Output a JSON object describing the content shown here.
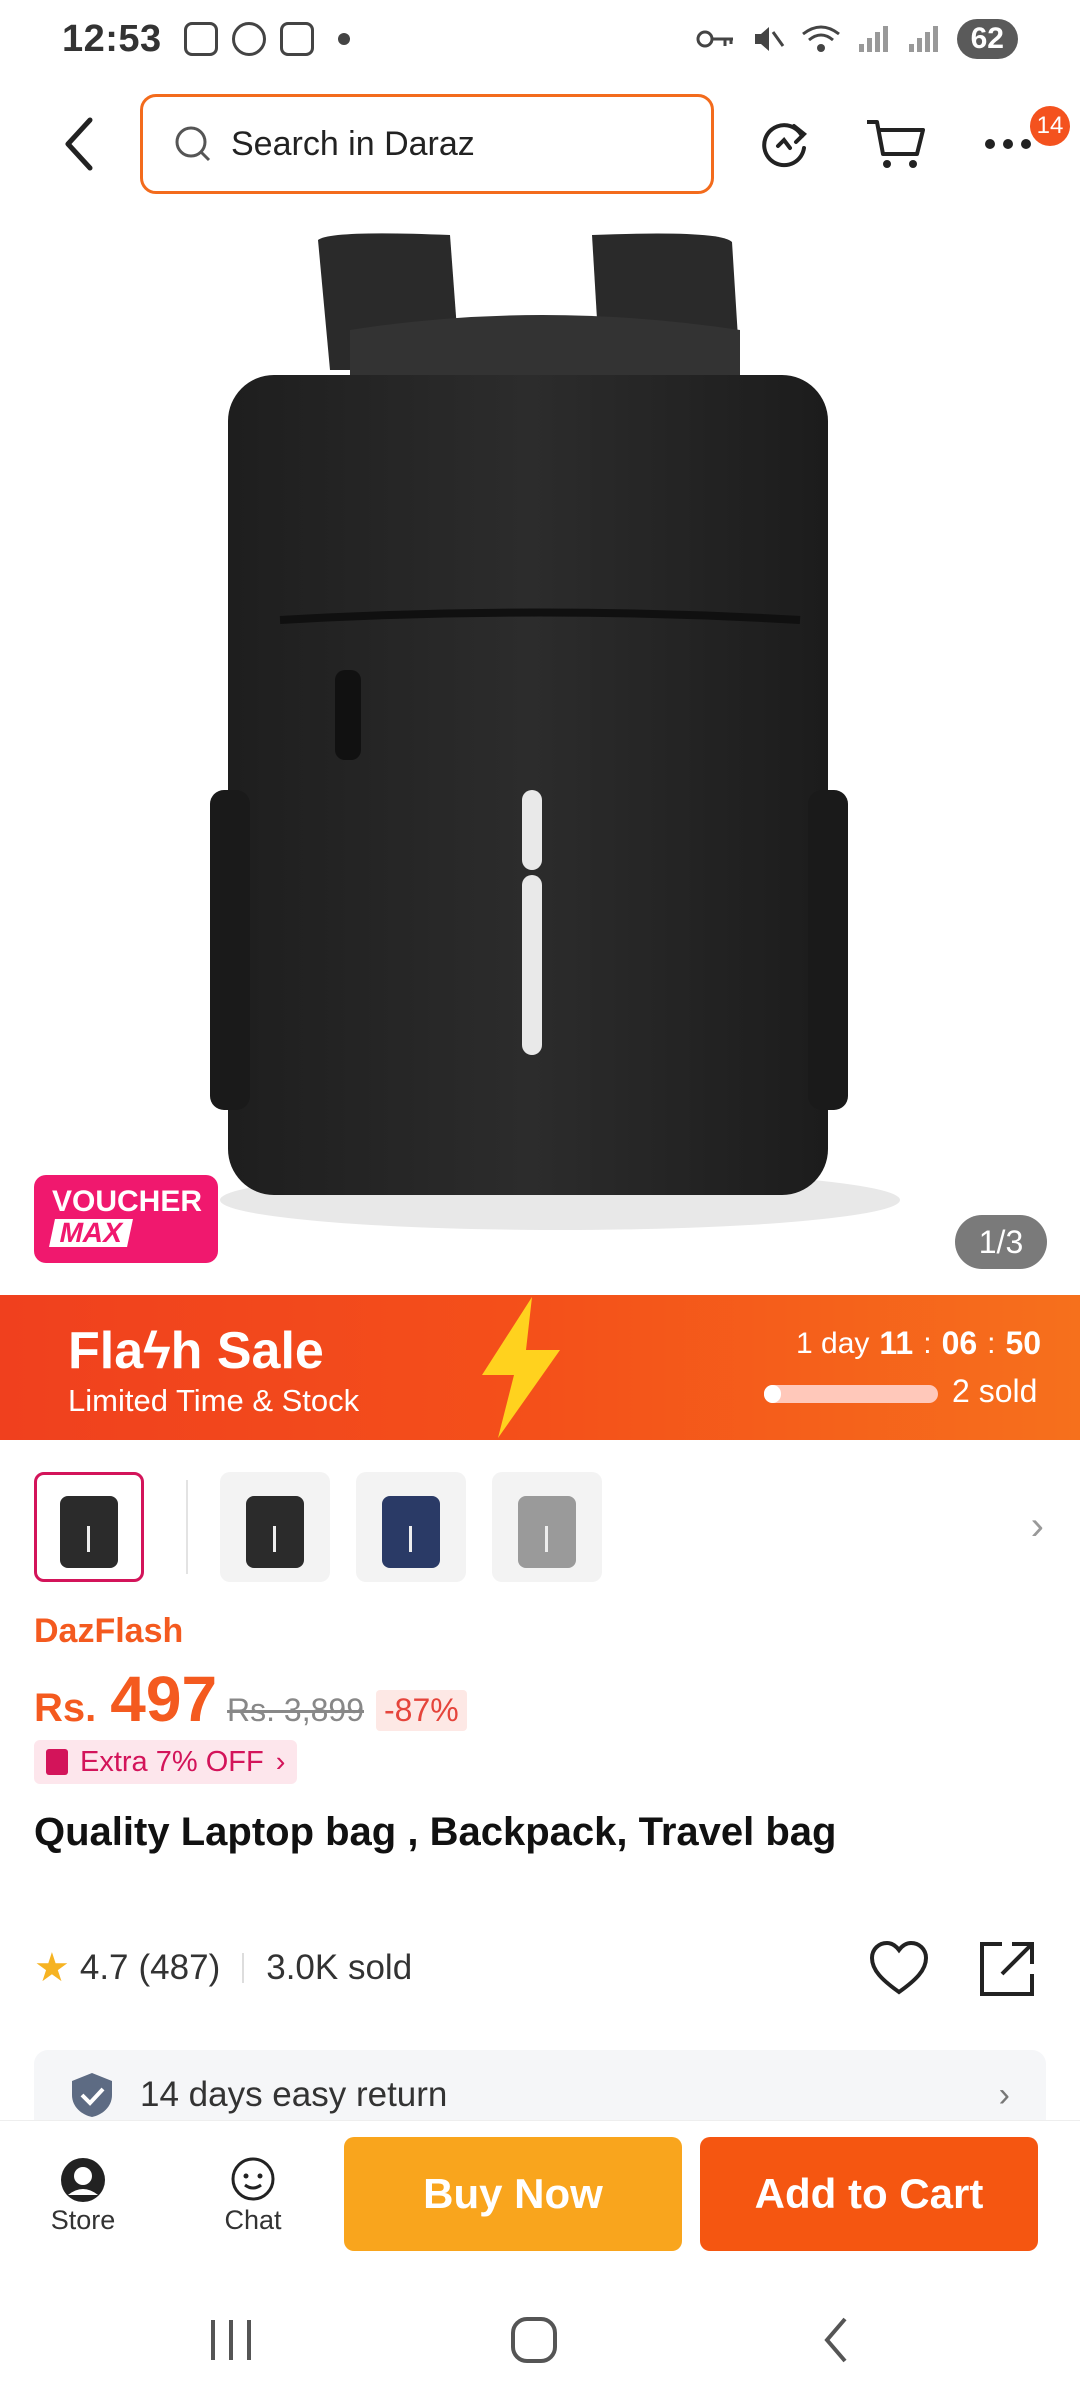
{
  "status_bar": {
    "time": "12:53",
    "battery": "62"
  },
  "header": {
    "search_placeholder": "Search in Daraz",
    "more_badge": "14"
  },
  "gallery": {
    "voucher_line1": "VOUCHER",
    "voucher_line2": "MAX",
    "counter": "1/3"
  },
  "flash_sale": {
    "title": "Flaϟh Sale",
    "subtitle": "Limited Time & Stock",
    "days_label": "1 day",
    "hours": "11",
    "minutes": "06",
    "seconds": "50",
    "sold": "2 sold",
    "sold_progress_percent": 10
  },
  "thumbnails": [
    {
      "name": "black-backpack",
      "color": "#2b2b2b"
    },
    {
      "name": "black-backpack-alt",
      "color": "#2b2b2b"
    },
    {
      "name": "navy-backpack",
      "color": "#2a3a66"
    },
    {
      "name": "grey-backpack",
      "color": "#9a9a9a"
    }
  ],
  "product": {
    "campaign": "DazFlash",
    "currency": "Rs.",
    "price": "497",
    "old_price": "Rs. 3,899",
    "discount": "-87%",
    "extra_off": "Extra 7% OFF",
    "title": "Quality Laptop bag , Backpack, Travel bag",
    "rating": "4.7",
    "reviews": "(487)",
    "sold": "3.0K sold",
    "return_policy": "14 days easy return"
  },
  "action_bar": {
    "store_label": "Store",
    "chat_label": "Chat",
    "buy_now": "Buy Now",
    "add_to_cart": "Add to Cart"
  },
  "colors": {
    "brand_orange": "#f55611",
    "buy_now_yellow": "#f9a51d",
    "voucher_pink": "#f0186e"
  }
}
